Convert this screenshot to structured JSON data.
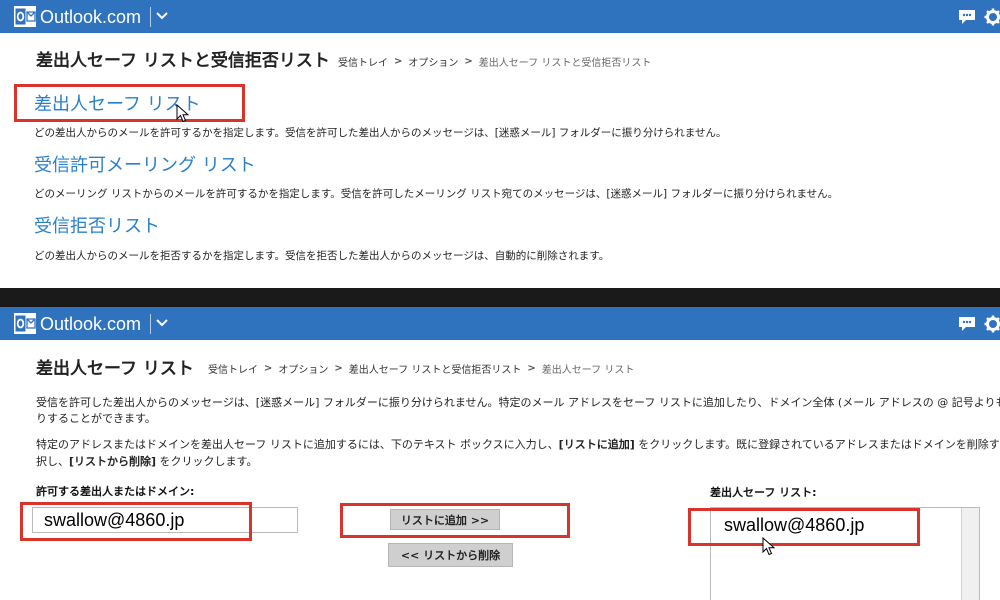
{
  "app": {
    "brand": "Outlook.com"
  },
  "top_panel": {
    "title": "差出人セーフ リストと受信拒否リスト",
    "breadcrumb": [
      "受信トレイ",
      "オプション",
      "差出人セーフ リストと受信拒否リスト"
    ],
    "sections": [
      {
        "link": "差出人セーフ リスト",
        "description": "どの差出人からのメールを許可するかを指定します。受信を許可した差出人からのメッセージは、[迷惑メール] フォルダーに振り分けられません。"
      },
      {
        "link": "受信許可メーリング リスト",
        "description": "どのメーリング リストからのメールを許可するかを指定します。受信を許可したメーリング リスト宛てのメッセージは、[迷惑メール] フォルダーに振り分けられません。"
      },
      {
        "link": "受信拒否リスト",
        "description": "どの差出人からのメールを拒否するかを指定します。受信を拒否した差出人からのメッセージは、自動的に削除されます。"
      }
    ]
  },
  "bottom_panel": {
    "title": "差出人セーフ リスト",
    "breadcrumb": [
      "受信トレイ",
      "オプション",
      "差出人セーフ リストと受信拒否リスト",
      "差出人セーフ リスト"
    ],
    "intro_line1": "受信を許可した差出人からのメッセージは、[迷惑メール] フォルダーに振り分けられません。特定のメール アドレスをセーフ リストに追加したり、ドメイン全体 (メール アドレスの @ 記号よりも後",
    "intro_line2": "りすることができます。",
    "instr_line1_a": "特定のアドレスまたはドメインを差出人セーフ リストに追加するには、下のテキスト ボックスに入力し、",
    "instr_line1_b": "[リストに追加]",
    "instr_line1_c": " をクリックします。既に登録されているアドレスまたはドメインを削除するに",
    "instr_line2_a": "択し、",
    "instr_line2_b": "[リストから削除]",
    "instr_line2_c": " をクリックします。",
    "input_label": "許可する差出人またはドメイン:",
    "input_value": "swallow@4860.jp",
    "add_button": "リストに追加 >>",
    "remove_button": "<< リストから削除",
    "list_label": "差出人セーフ リスト:",
    "list_items": [
      "swallow@4860.jp"
    ]
  },
  "colors": {
    "header_bar": "#2f72be",
    "link": "#2a7fc9",
    "highlight": "#d9342b"
  }
}
